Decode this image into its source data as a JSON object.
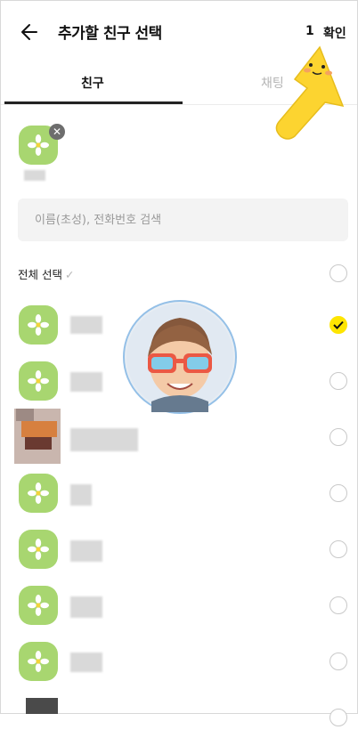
{
  "header": {
    "title": "추가할 친구 선택",
    "count": "1",
    "confirm_label": "확인"
  },
  "tabs": [
    {
      "label": "친구",
      "active": true
    },
    {
      "label": "채팅",
      "active": false
    }
  ],
  "search": {
    "placeholder": "이름(초성), 전화번호 검색",
    "value": ""
  },
  "select_all": {
    "label": "전체 선택"
  },
  "friends": [
    {
      "avatar": "flower-avatar",
      "selected": true
    },
    {
      "avatar": "flower-avatar",
      "selected": false
    },
    {
      "avatar": "photo-avatar",
      "selected": false
    },
    {
      "avatar": "flower-avatar",
      "selected": false
    },
    {
      "avatar": "flower-avatar",
      "selected": false
    },
    {
      "avatar": "flower-avatar",
      "selected": false
    },
    {
      "avatar": "flower-avatar",
      "selected": false
    },
    {
      "avatar": "photo-avatar",
      "selected": false
    }
  ],
  "colors": {
    "accent": "#fee500",
    "avatar_bg": "#a8d670"
  }
}
